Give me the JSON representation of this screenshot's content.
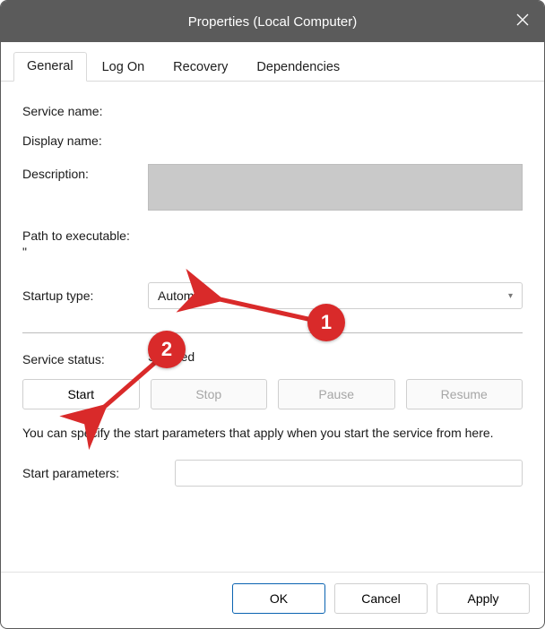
{
  "window": {
    "title": "Properties (Local Computer)"
  },
  "tabs": {
    "general": "General",
    "logon": "Log On",
    "recovery": "Recovery",
    "dependencies": "Dependencies",
    "active": "general"
  },
  "labels": {
    "service_name": "Service name:",
    "display_name": "Display name:",
    "description": "Description:",
    "path": "Path to executable:",
    "startup_type": "Startup type:",
    "service_status": "Service status:",
    "hint": "You can specify the start parameters that apply when you start the service from here.",
    "start_parameters": "Start parameters:"
  },
  "values": {
    "service_name": "",
    "display_name": "",
    "path": "\"",
    "startup_type": "Automatic",
    "service_status": "Stopped",
    "start_parameters": ""
  },
  "buttons": {
    "start": "Start",
    "stop": "Stop",
    "pause": "Pause",
    "resume": "Resume",
    "ok": "OK",
    "cancel": "Cancel",
    "apply": "Apply"
  },
  "annotations": {
    "badge1": "1",
    "badge2": "2"
  }
}
